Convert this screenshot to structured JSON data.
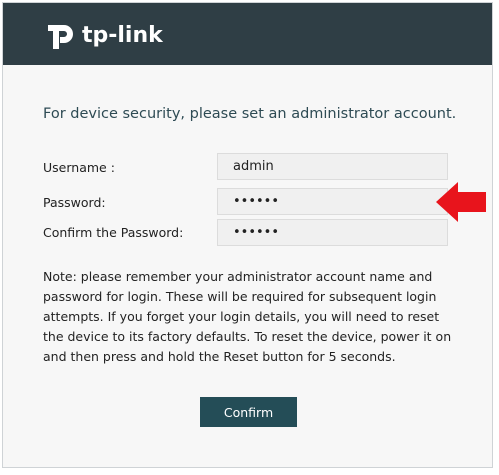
{
  "brand": {
    "name": "tp-link",
    "header_color": "#2f3e45"
  },
  "headline": "For device security, please set an administrator account.",
  "form": {
    "username_label": "Username :",
    "username_value": "admin",
    "password_label": "Password:",
    "password_value": "••••••",
    "confirm_label": "Confirm the Password:",
    "confirm_value": "••••••"
  },
  "note": "Note: please remember your administrator account name and password for login. These will be required for subsequent login attempts. If you forget your login details, you will need to reset the device to its factory defaults. To reset the device, power it on and then press and hold the Reset button for 5 seconds.",
  "confirm_button": {
    "label": "Confirm",
    "color": "#244d57"
  },
  "annotation": {
    "icon": "left-arrow-icon",
    "color": "#e8141c"
  }
}
